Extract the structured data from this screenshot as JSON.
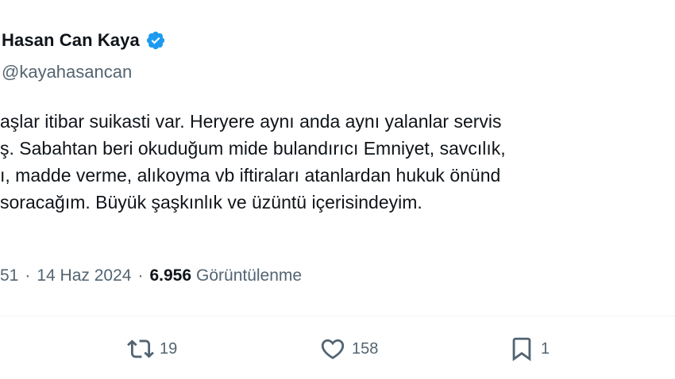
{
  "author": {
    "name": "Hasan Can Kaya",
    "handle": "@kayahasancan",
    "verified_icon": "verified-badge-icon",
    "verified_color": "#1d9bf0"
  },
  "tweet": {
    "lines": [
      "aşlar itibar suikasti var. Heryere aynı anda aynı yalanlar servis",
      "ş. Sabahtan beri okuduğum mide bulandırıcı Emniyet, savcılık,",
      "ı, madde verme, alıkoyma vb iftiraları atanlardan hukuk önünd",
      " soracağım. Büyük şaşkınlık ve üzüntü içerisindeyim."
    ]
  },
  "meta": {
    "time": "51",
    "separator": "·",
    "date": "14 Haz 2024",
    "views_count": "6.956",
    "views_label": "Görüntülenme"
  },
  "actions": {
    "retweet": {
      "icon": "retweet-icon",
      "count": "19"
    },
    "like": {
      "icon": "heart-icon",
      "count": "158"
    },
    "bookmark": {
      "icon": "bookmark-icon",
      "count": "1"
    }
  },
  "colors": {
    "text_primary": "#0f1419",
    "text_secondary": "#536471",
    "divider": "#eff3f4"
  }
}
